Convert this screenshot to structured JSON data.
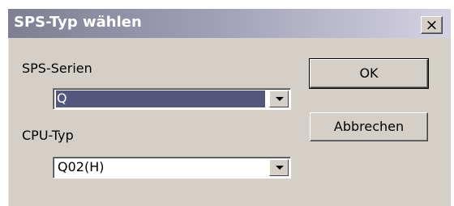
{
  "dialog": {
    "title": "SPS-Typ wählen",
    "close_label": "×"
  },
  "form": {
    "series_label": "SPS-Serien",
    "series_value": "Q",
    "cpu_label": "CPU-Typ",
    "cpu_value": "Q02(H)"
  },
  "buttons": {
    "ok_label": "OK",
    "cancel_label": "Abbrechen"
  },
  "colors": {
    "title_gradient_start": "#7f7f93",
    "title_gradient_end": "#d4d2e2",
    "dialog_face": "#d4d0c8",
    "selection": "#55567b"
  }
}
